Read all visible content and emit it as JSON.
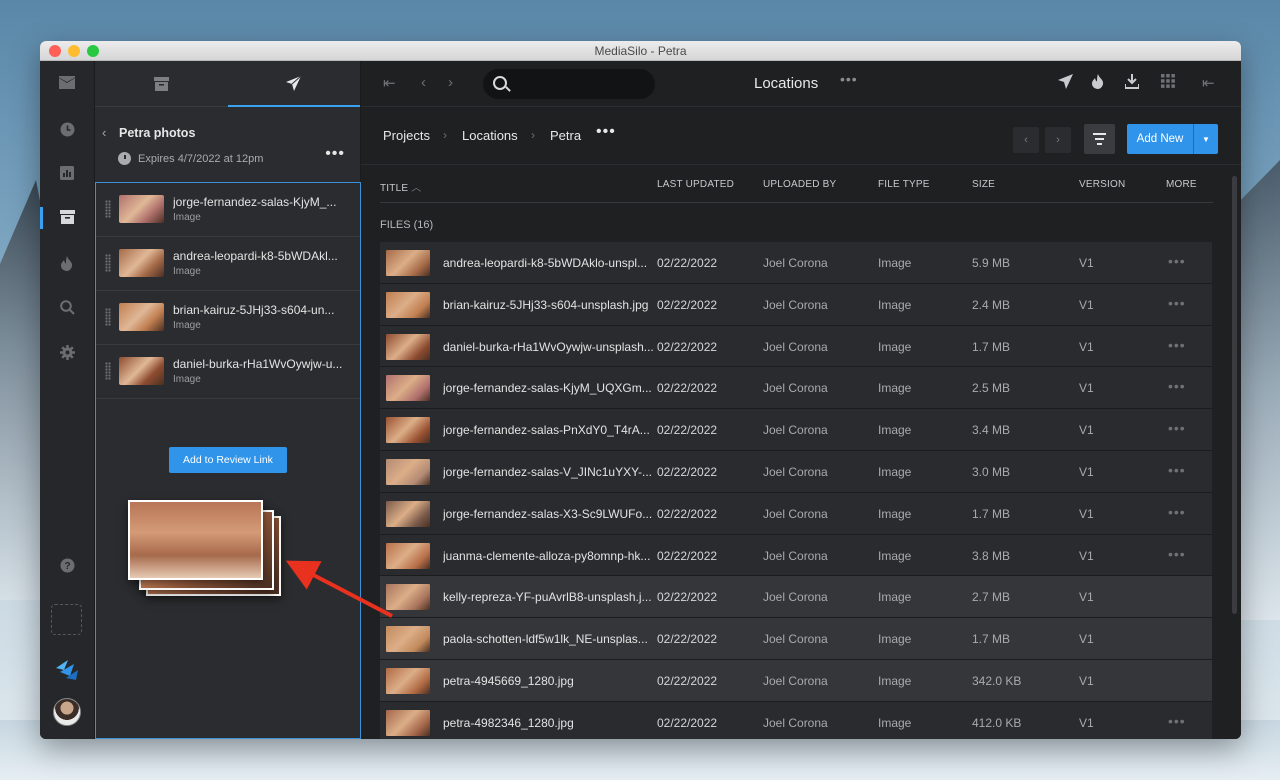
{
  "window": {
    "title": "MediaSilo - Petra"
  },
  "rail": {
    "icons": [
      "inbox-icon",
      "clock-icon",
      "chart-icon",
      "archive-icon",
      "fire-icon",
      "search-icon",
      "gear-icon",
      "help-icon",
      "add-icon",
      "logo-icon"
    ]
  },
  "panel": {
    "title": "Petra photos",
    "expires": "Expires 4/7/2022 at 12pm",
    "items": [
      {
        "name": "jorge-fernandez-salas-KjyM_...",
        "type": "Image",
        "color": "#b0706c"
      },
      {
        "name": "andrea-leopardi-k8-5bWDAkl...",
        "type": "Image",
        "color": "#a56a48"
      },
      {
        "name": "brian-kairuz-5JHj33-s604-un...",
        "type": "Image",
        "color": "#c07e50"
      },
      {
        "name": "daniel-burka-rHa1WvOywjw-u...",
        "type": "Image",
        "color": "#8e4c30"
      }
    ],
    "add_button": "Add to Review Link"
  },
  "topbar": {
    "title": "Locations",
    "search_placeholder": ""
  },
  "breadcrumb": {
    "items": [
      "Projects",
      "Locations",
      "Petra"
    ]
  },
  "actions": {
    "add_new": "Add New"
  },
  "table": {
    "headers": {
      "title": "TITLE",
      "updated": "LAST UPDATED",
      "by": "UPLOADED BY",
      "type": "FILE TYPE",
      "size": "SIZE",
      "version": "VERSION",
      "more": "MORE"
    },
    "files_label": "FILES (16)",
    "rows": [
      {
        "name": "andrea-leopardi-k8-5bWDAklo-unspl...",
        "date": "02/22/2022",
        "by": "Joel Corona",
        "type": "Image",
        "size": "5.9 MB",
        "ver": "V1",
        "color": "#a56a48",
        "more": "•••"
      },
      {
        "name": "brian-kairuz-5JHj33-s604-unsplash.jpg",
        "date": "02/22/2022",
        "by": "Joel Corona",
        "type": "Image",
        "size": "2.4 MB",
        "ver": "V1",
        "color": "#c07e50",
        "more": "•••"
      },
      {
        "name": "daniel-burka-rHa1WvOywjw-unsplash...",
        "date": "02/22/2022",
        "by": "Joel Corona",
        "type": "Image",
        "size": "1.7 MB",
        "ver": "V1",
        "color": "#8e4c30",
        "more": "•••"
      },
      {
        "name": "jorge-fernandez-salas-KjyM_UQXGm...",
        "date": "02/22/2022",
        "by": "Joel Corona",
        "type": "Image",
        "size": "2.5 MB",
        "ver": "V1",
        "color": "#b0706c",
        "more": "•••"
      },
      {
        "name": "jorge-fernandez-salas-PnXdY0_T4rA...",
        "date": "02/22/2022",
        "by": "Joel Corona",
        "type": "Image",
        "size": "3.4 MB",
        "ver": "V1",
        "color": "#9a5232",
        "more": "•••"
      },
      {
        "name": "jorge-fernandez-salas-V_JINc1uYXY-...",
        "date": "02/22/2022",
        "by": "Joel Corona",
        "type": "Image",
        "size": "3.0 MB",
        "ver": "V1",
        "color": "#b38a74",
        "more": "•••"
      },
      {
        "name": "jorge-fernandez-salas-X3-Sc9LWUFo...",
        "date": "02/22/2022",
        "by": "Joel Corona",
        "type": "Image",
        "size": "1.7 MB",
        "ver": "V1",
        "color": "#7a5a4a",
        "more": "•••"
      },
      {
        "name": "juanma-clemente-alloza-py8omnp-hk...",
        "date": "02/22/2022",
        "by": "Joel Corona",
        "type": "Image",
        "size": "3.8 MB",
        "ver": "V1",
        "color": "#b8704a",
        "more": "•••"
      },
      {
        "name": "kelly-repreza-YF-puAvrlB8-unsplash.j...",
        "date": "02/22/2022",
        "by": "Joel Corona",
        "type": "Image",
        "size": "2.7 MB",
        "ver": "V1",
        "color": "#a8745c",
        "more": ""
      },
      {
        "name": "paola-schotten-ldf5w1lk_NE-unsplas...",
        "date": "02/22/2022",
        "by": "Joel Corona",
        "type": "Image",
        "size": "1.7 MB",
        "ver": "V1",
        "color": "#c28a5c",
        "more": ""
      },
      {
        "name": "petra-4945669_1280.jpg",
        "date": "02/22/2022",
        "by": "Joel Corona",
        "type": "Image",
        "size": "342.0 KB",
        "ver": "V1",
        "color": "#b06a44",
        "more": ""
      },
      {
        "name": "petra-4982346_1280.jpg",
        "date": "02/22/2022",
        "by": "Joel Corona",
        "type": "Image",
        "size": "412.0 KB",
        "ver": "V1",
        "color": "#a4664a",
        "more": "•••"
      }
    ]
  },
  "colors": {
    "accent": "#2f94ea",
    "window_bg": "#1f2022",
    "panel_bg": "#2b2c2f"
  }
}
